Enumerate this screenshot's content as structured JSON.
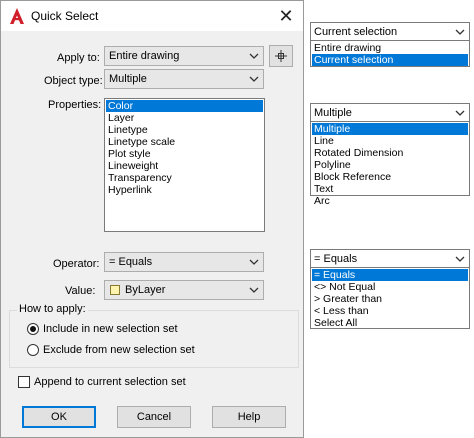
{
  "dialog": {
    "title": "Quick Select",
    "close_label": "✕",
    "apply_to": {
      "label": "Apply to:",
      "value": "Entire drawing"
    },
    "object_type": {
      "label": "Object type:",
      "value": "Multiple"
    },
    "properties": {
      "label": "Properties:",
      "items": [
        "Color",
        "Layer",
        "Linetype",
        "Linetype scale",
        "Plot style",
        "Lineweight",
        "Transparency",
        "Hyperlink"
      ],
      "selected_index": 0
    },
    "operator": {
      "label": "Operator:",
      "value": "= Equals"
    },
    "value": {
      "label": "Value:",
      "value": "ByLayer",
      "swatch_color": "#fff3b0"
    },
    "how_to_apply": {
      "label": "How to apply:",
      "include": "Include in new selection set",
      "exclude": "Exclude from new selection set",
      "selected": "include"
    },
    "append": {
      "label": "Append to current selection set",
      "checked": false
    },
    "buttons": {
      "ok": "OK",
      "cancel": "Cancel",
      "help": "Help"
    }
  },
  "dropdown_apply_to": {
    "current": "Current selection",
    "options": [
      "Entire drawing",
      "Current selection"
    ],
    "selected_index": 1
  },
  "dropdown_object_type": {
    "current": "Multiple",
    "options": [
      "Multiple",
      "Line",
      "Rotated Dimension",
      "Polyline",
      "Block Reference",
      "Text",
      "Arc"
    ],
    "selected_index": 0
  },
  "dropdown_operator": {
    "current": "= Equals",
    "options": [
      "= Equals",
      "<> Not Equal",
      "> Greater than",
      "< Less than",
      "Select All"
    ],
    "selected_index": 0
  },
  "colors": {
    "accent": "#0078d7",
    "app_icon": "#d01f2a",
    "dialog_bg": "#f0f0f0"
  }
}
